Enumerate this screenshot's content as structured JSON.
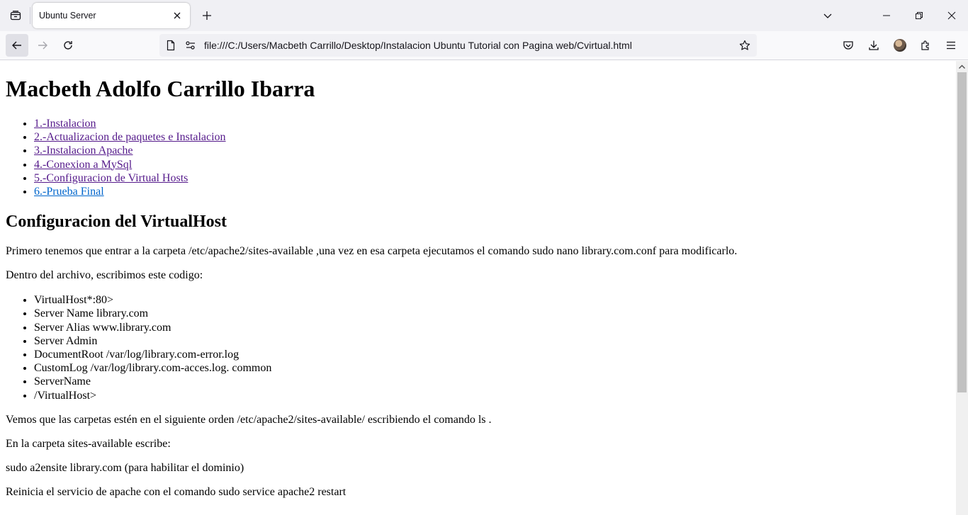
{
  "browser": {
    "tab_title": "Ubuntu Server",
    "url": "file:///C:/Users/Macbeth Carrillo/Desktop/Instalacion Ubuntu Tutorial con Pagina web/Cvirtual.html"
  },
  "page": {
    "title": "Macbeth Adolfo Carrillo Ibarra",
    "nav_links": [
      {
        "label": "1.-Instalacion",
        "state": "visited"
      },
      {
        "label": "2.-Actualizacion de paquetes e Instalacion",
        "state": "visited"
      },
      {
        "label": "3.-Instalacion Apache",
        "state": "visited"
      },
      {
        "label": "4.-Conexion a MySql",
        "state": "visited"
      },
      {
        "label": "5.-Configuracion de Virtual Hosts",
        "state": "visited"
      },
      {
        "label": "6.-Prueba Final",
        "state": "link"
      }
    ],
    "section_heading": "Configuracion del VirtualHost",
    "para1": "Primero tenemos que entrar a la carpeta /etc/apache2/sites-available ,una vez en esa carpeta ejecutamos el comando sudo nano library.com.conf para modificarlo.",
    "para2": "Dentro del archivo, escribimos este codigo:",
    "code_items": [
      "VirtualHost*:80>",
      "Server Name library.com",
      "Server Alias www.library.com",
      "Server Admin",
      "DocumentRoot /var/log/library.com-error.log",
      "CustomLog /var/log/library.com-acces.log. common",
      "ServerName",
      "/VirtualHost>"
    ],
    "para3": "Vemos que las carpetas estén en el siguiente orden /etc/apache2/sites-available/ escribiendo el comando ls .",
    "para4": "En la carpeta sites-available escribe:",
    "para5": "sudo a2ensite library.com (para habilitar el dominio)",
    "para6": "Reinicia el servicio de apache con el comando sudo service apache2 restart"
  },
  "colors": {
    "visited_link": "#551a8b",
    "link": "#0066cc"
  }
}
